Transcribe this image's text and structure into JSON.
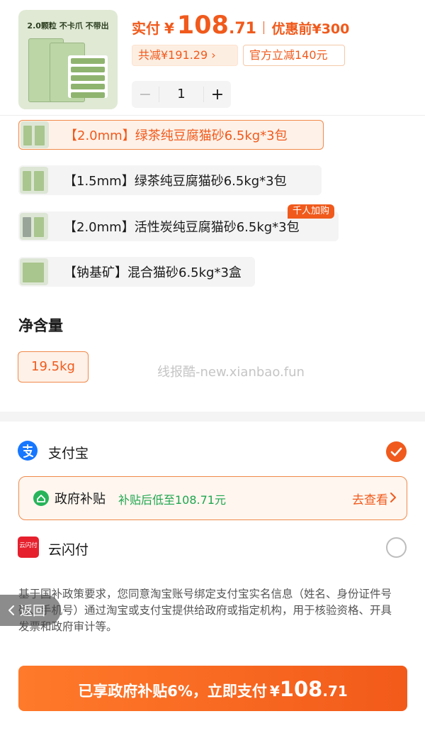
{
  "product": {
    "image_caption": "2.0颗粒 不卡爪 不带出",
    "price_label": "实付",
    "currency": "¥",
    "price_integer": "108",
    "price_decimal": ".71",
    "original_price": "优惠前¥300",
    "discount_chip": "共减¥191.29 ›",
    "official_chip": "官方立减140元",
    "quantity": "1",
    "minus": "−",
    "plus": "+"
  },
  "variants": [
    {
      "label": "【2.0mm】绿茶纯豆腐猫砂6.5kg*3包",
      "selected": true
    },
    {
      "label": "【1.5mm】绿茶纯豆腐猫砂6.5kg*3包",
      "selected": false
    },
    {
      "label": "【2.0mm】活性炭纯豆腐猫砂6.5kg*3包",
      "selected": false,
      "badge": "千人加购"
    },
    {
      "label": "【钠基矿】混合猫砂6.5kg*3盒",
      "selected": false
    }
  ],
  "net_content": {
    "title": "净含量",
    "option": "19.5kg"
  },
  "watermark": "线报酷-new.xianbao.fun",
  "payment": {
    "alipay": "支付宝",
    "subsidy_title": "政府补贴",
    "subsidy_desc": "补贴后低至108.71元",
    "subsidy_link": "去查看",
    "unionpay": "云闪付",
    "unionpay_icon_text": "云闪付",
    "notice": "基于国补政策要求，您同意淘宝账号绑定支付宝实名信息（姓名、身份证件号码、手机号）通过淘宝或支付宝提供给政府或指定机构，用于核验资格、开具发票和政府审计等。",
    "back": "返回"
  },
  "pay_button": {
    "text": "已享政府补贴6%，立即支付",
    "currency": "¥",
    "integer": "108",
    "decimal": ".71"
  },
  "colors": {
    "accent": "#f05a1c",
    "accent_light": "#fef1e8",
    "subsidy_green": "#1fa64f",
    "alipay_blue": "#1677ff",
    "unionpay_red": "#e6202d"
  }
}
